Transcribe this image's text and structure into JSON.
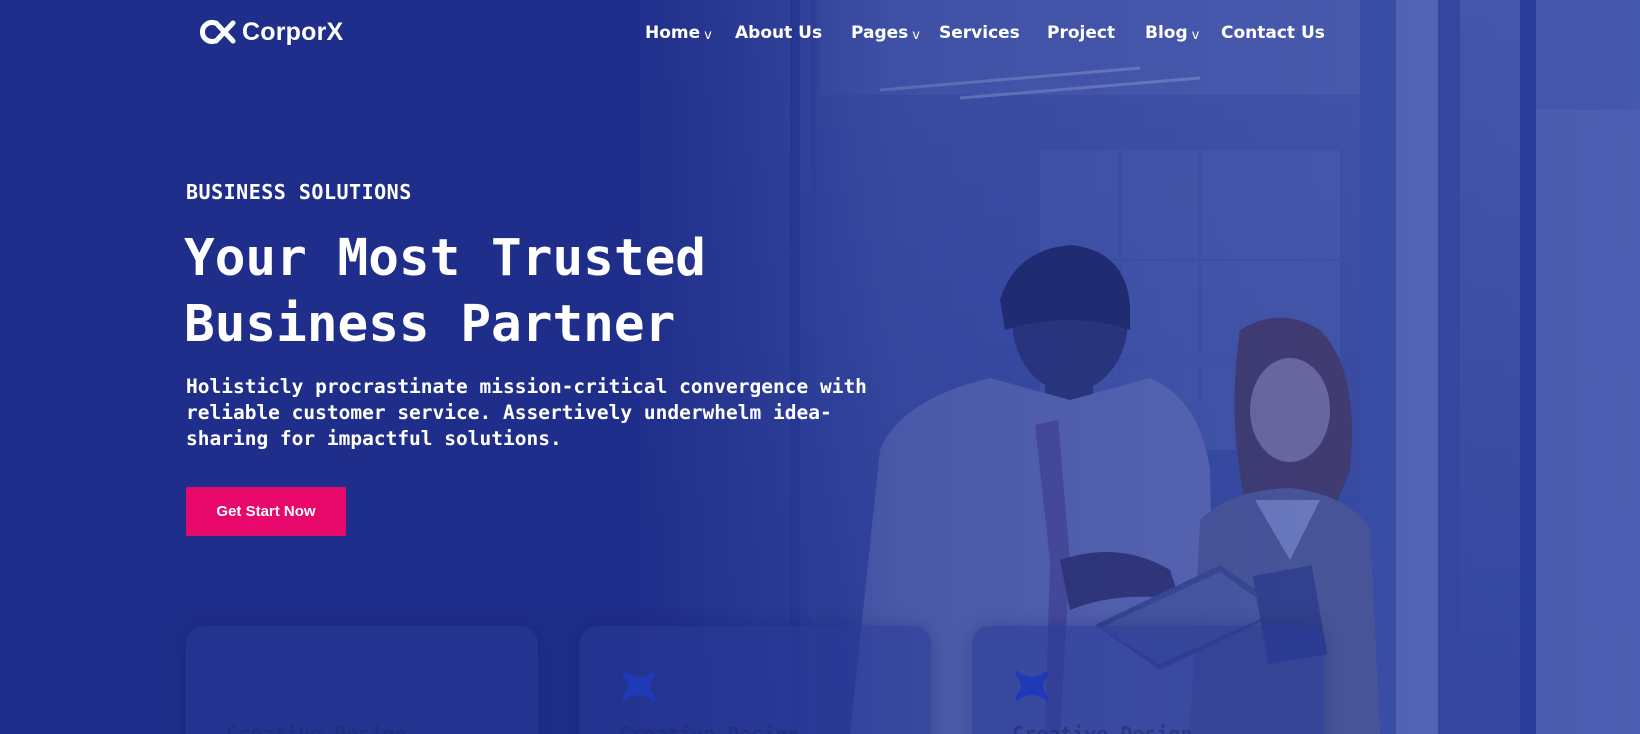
{
  "brand": {
    "name": "CorporX",
    "accent": "#e8086b",
    "background": "#1c2b84"
  },
  "nav": {
    "items": [
      {
        "label": "Home",
        "chevron": "v"
      },
      {
        "label": "About Us",
        "chevron": ""
      },
      {
        "label": "Pages",
        "chevron": "v"
      },
      {
        "label": "Services",
        "chevron": ""
      },
      {
        "label": "Project",
        "chevron": ""
      },
      {
        "label": "Blog",
        "chevron": "v"
      },
      {
        "label": "Contact Us",
        "chevron": ""
      }
    ]
  },
  "hero": {
    "eyebrow": "BUSINESS SOLUTIONS",
    "headline_line1": "Your Most Trusted",
    "headline_line2": "Business Partner",
    "subtext": "Holisticly procrastinate mission-critical convergence with reliable customer service. Assertively underwhelm idea-sharing for impactful solutions.",
    "cta_label": "Get Start Now"
  },
  "cards": [
    {
      "title": "Creative Design",
      "icon": "x-shape-icon"
    },
    {
      "title": "Creative Design",
      "icon": "x-shape-icon"
    },
    {
      "title": "Creative Design",
      "icon": "x-shape-icon"
    }
  ]
}
